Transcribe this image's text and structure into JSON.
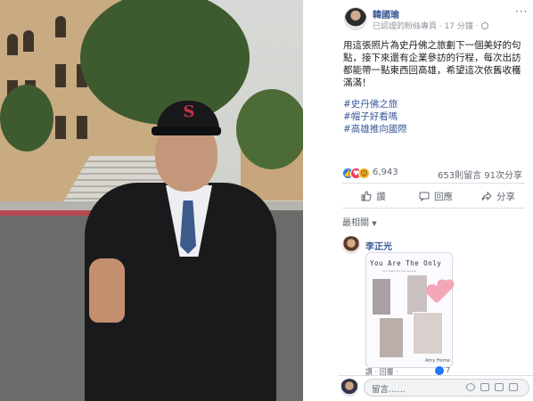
{
  "page": {
    "name": "韓國瑜",
    "meta": "已認證的粉絲專頁 · 17 分鐘 ·",
    "more_label": "···"
  },
  "post": {
    "text": "用這張照片為史丹佛之旅劃下一個美好的句點，接下來還有企業參訪的行程，每次出訪都能帶一點東西回高雄，希望這次依舊收穫滿滿！",
    "hashtags": [
      "#史丹佛之旅",
      "#帽子好看嗎",
      "#高雄推向國際"
    ]
  },
  "stats": {
    "reactions": "6,943",
    "comments": "653則留言",
    "shares": "91次分享"
  },
  "actions": {
    "like": "讚",
    "comment": "回應",
    "share": "分享"
  },
  "comments_section": {
    "sort_label": "最相關",
    "comment_author": "李正光",
    "card_title": "You Are The Only",
    "card_sub": "You make me feel special",
    "card_sign": "Amy Horne",
    "reply_actions": "讚 · 回覆 ·",
    "reaction_count": "7"
  },
  "composer": {
    "placeholder": "留言……"
  },
  "colors": {
    "link": "#385898",
    "like": "#2078f4",
    "love": "#f33e58",
    "haha": "#f7b125"
  }
}
